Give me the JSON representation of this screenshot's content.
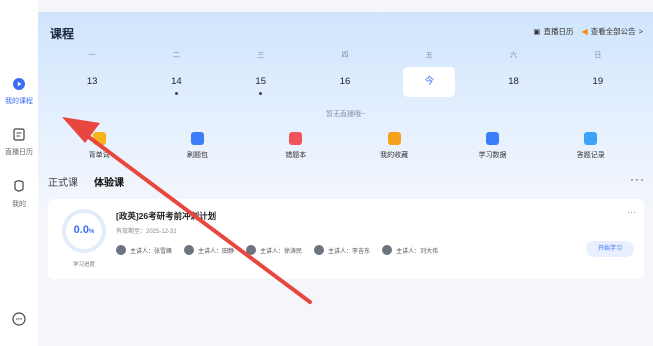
{
  "sidebar": {
    "items": [
      {
        "label": "我的课程",
        "icon": "play-circle-icon",
        "active": true
      },
      {
        "label": "直播日历",
        "icon": "calendar-icon"
      },
      {
        "label": "我的",
        "icon": "profile-icon"
      }
    ],
    "help_icon": "chat-bubble-icon"
  },
  "header": {
    "title": "课程",
    "calendar_link": "直播日历",
    "notice_link": "查看全部公告",
    "chevron": ">"
  },
  "calendar": {
    "weekdays": [
      "一",
      "二",
      "三",
      "四",
      "五",
      "六",
      "日"
    ],
    "days": [
      {
        "label": "13",
        "dot": false
      },
      {
        "label": "14",
        "dot": true
      },
      {
        "label": "15",
        "dot": true
      },
      {
        "label": "16",
        "dot": false
      },
      {
        "label": "今",
        "dot": false,
        "today": true
      },
      {
        "label": "18",
        "dot": false
      },
      {
        "label": "19",
        "dot": false
      }
    ],
    "empty_text": "暂无直播哦~"
  },
  "shortcuts": [
    {
      "label": "背单词",
      "color": "#f6b21b"
    },
    {
      "label": "刷题包",
      "color": "#3c7dfb"
    },
    {
      "label": "错题本",
      "color": "#f0535a"
    },
    {
      "label": "我的收藏",
      "color": "#f6a01b"
    },
    {
      "label": "学习数据",
      "color": "#3c7dfb"
    },
    {
      "label": "答题记录",
      "color": "#3ca3fb"
    }
  ],
  "tabs": [
    {
      "label": "正式课",
      "active": false
    },
    {
      "label": "体验课",
      "active": true
    }
  ],
  "tabs_more": "···",
  "course": {
    "progress": "0.0",
    "progress_unit": "%",
    "progress_label": "学习进度",
    "title": "[政英]26考研考前冲刺计划",
    "expiry": "有效期至：2025-12-31",
    "menu": "···",
    "teachers": [
      {
        "label": "主讲人：张雪峰"
      },
      {
        "label": "主讲人：田静"
      },
      {
        "label": "主讲人：徐涛民"
      },
      {
        "label": "主讲人：李吉东"
      },
      {
        "label": "主讲人：刘大伟"
      }
    ],
    "start_button": "开始学习"
  },
  "colors": {
    "accent": "#3b6cf5",
    "annotation_arrow": "#e8473f"
  }
}
